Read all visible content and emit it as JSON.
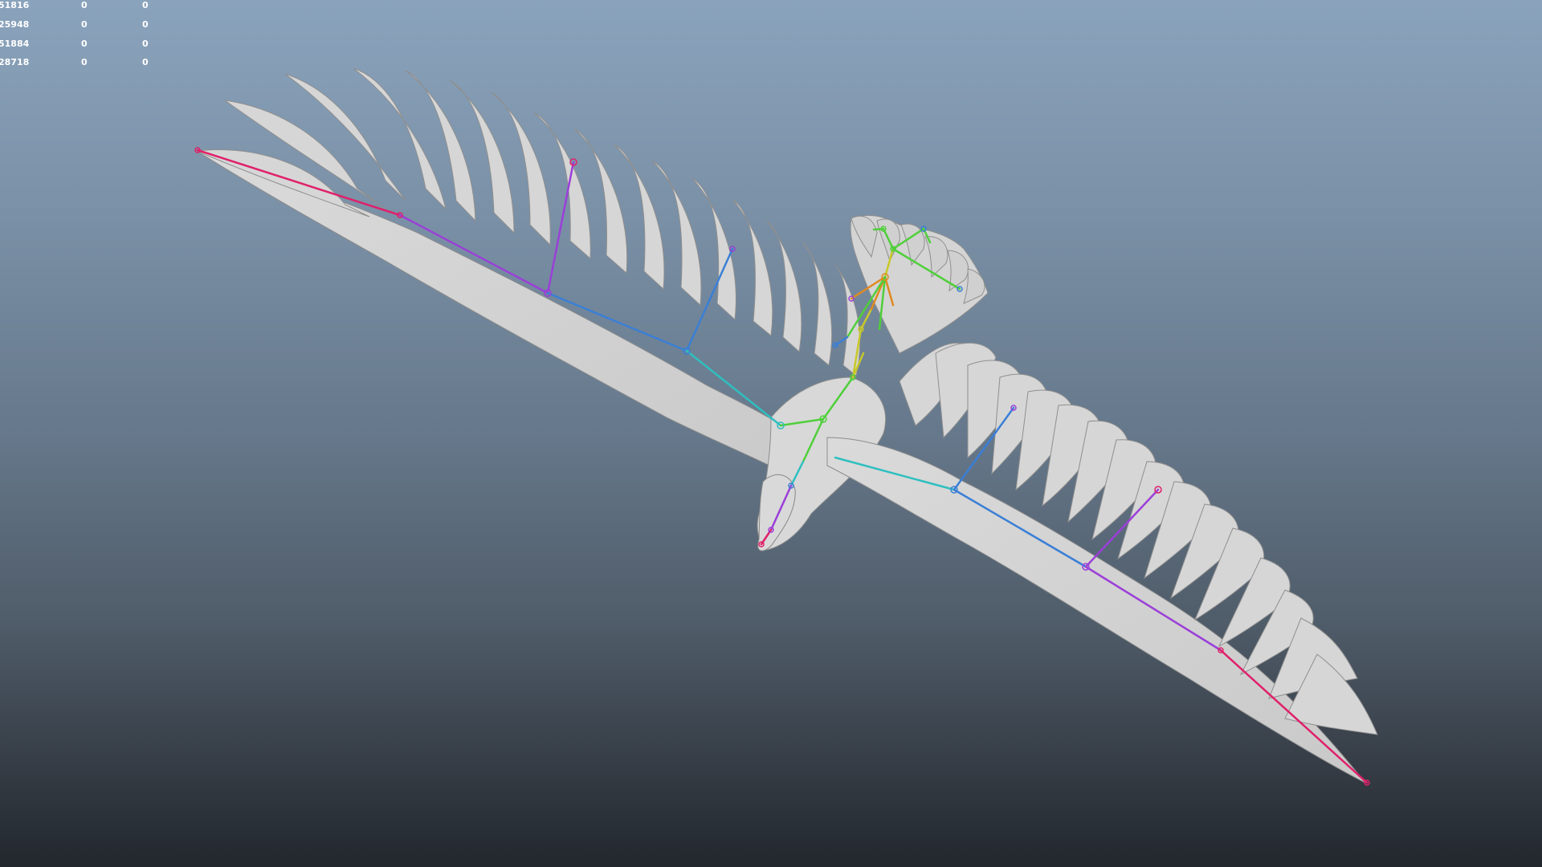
{
  "viewport": {
    "background_top": "#8aa3bc",
    "background_bottom": "#22272d"
  },
  "hud": {
    "rows": [
      {
        "value": "51816",
        "col2": "0",
        "col3": "0"
      },
      {
        "value": "25948",
        "col2": "0",
        "col3": "0"
      },
      {
        "value": "51884",
        "col2": "0",
        "col3": "0"
      },
      {
        "value": "28718",
        "col2": "0",
        "col3": "0"
      }
    ]
  },
  "model": {
    "mesh_color": "#d9d9d9",
    "bone_colors": [
      "#e0206a",
      "#9b3fd8",
      "#3a7fd6",
      "#2fbfbf",
      "#4fcf3a",
      "#c8c82a",
      "#e08a1f"
    ]
  }
}
